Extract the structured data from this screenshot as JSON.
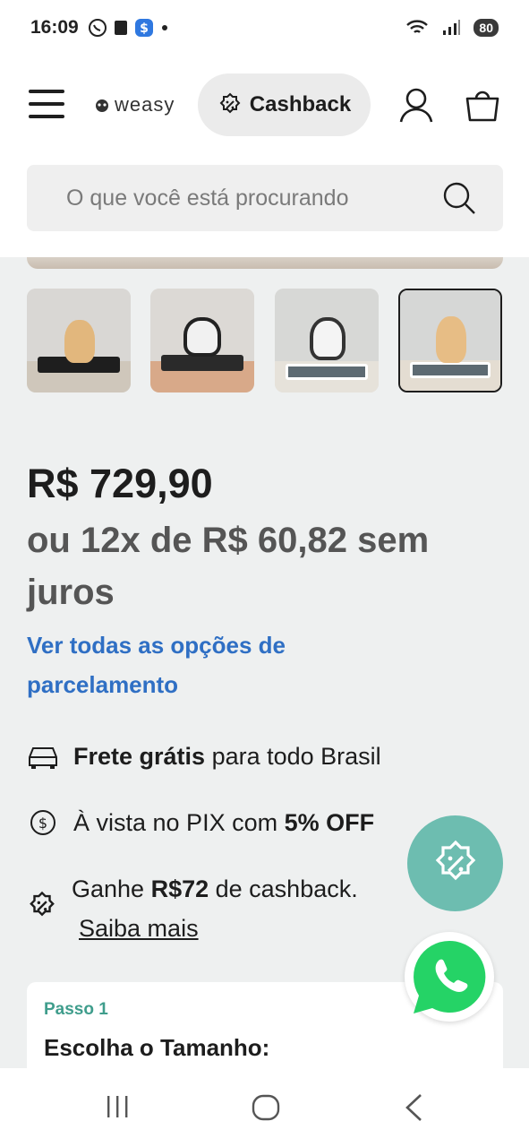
{
  "status_bar": {
    "time": "16:09",
    "battery": "80",
    "icons": [
      "whatsapp-icon",
      "notes-icon",
      "dollar-app-icon",
      "dot-icon",
      "wifi-icon",
      "signal-icon",
      "battery-icon"
    ]
  },
  "header": {
    "logo_text": "weasy",
    "cashback_label": "Cashback",
    "search_placeholder": "O que você está procurando"
  },
  "gallery": {
    "thumbnails": [
      "thumb-1",
      "thumb-2",
      "thumb-3",
      "thumb-4"
    ],
    "selected_index": 3
  },
  "pricing": {
    "price": "R$ 729,90",
    "installments": "ou 12x de R$ 60,82 sem juros",
    "installment_link": "Ver todas as opções de parcelamento"
  },
  "benefits": {
    "shipping_bold": "Frete grátis",
    "shipping_rest": " para todo Brasil",
    "pix_pre": "À vista no PIX com ",
    "pix_bold": "5% OFF",
    "cashback_pre": "Ganhe ",
    "cashback_bold": "R$72",
    "cashback_post": " de cashback.",
    "saiba_mais": "Saiba mais"
  },
  "step": {
    "label": "Passo 1",
    "title": "Escolha o Tamanho:"
  },
  "colors": {
    "accent_teal": "#6dbdb0",
    "link_blue": "#2f6fc4",
    "whatsapp_green": "#25d366"
  }
}
